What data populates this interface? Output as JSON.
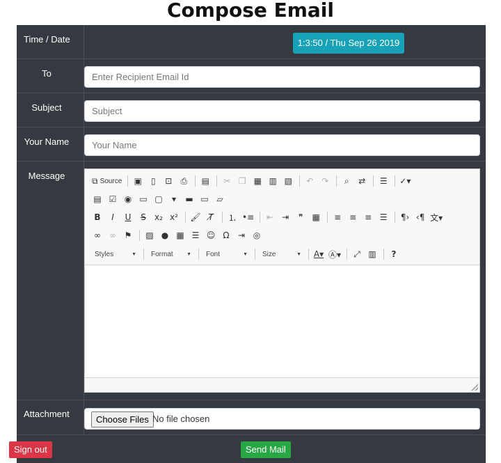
{
  "page": {
    "title": "Compose Email"
  },
  "rows": {
    "time_date": {
      "label": "Time / Date",
      "value": "1:3:50 / Thu Sep 26 2019"
    },
    "to": {
      "label": "To",
      "placeholder": "Enter Recipient Email Id"
    },
    "subject": {
      "label": "Subject",
      "placeholder": "Subject"
    },
    "your_name": {
      "label": "Your Name",
      "placeholder": "Your Name"
    },
    "message": {
      "label": "Message"
    },
    "attachment": {
      "label": "Attachment",
      "button": "Choose Files",
      "status": "No file chosen"
    }
  },
  "editor": {
    "source_label": "Source",
    "styles_label": "Styles",
    "format_label": "Format",
    "font_label": "Font",
    "size_label": "Size"
  },
  "actions": {
    "sign_out": "Sign out",
    "send": "Send Mail"
  },
  "colors": {
    "panel": "#343a40",
    "info": "#17a2b8",
    "danger": "#dc3545",
    "success": "#28a745"
  }
}
